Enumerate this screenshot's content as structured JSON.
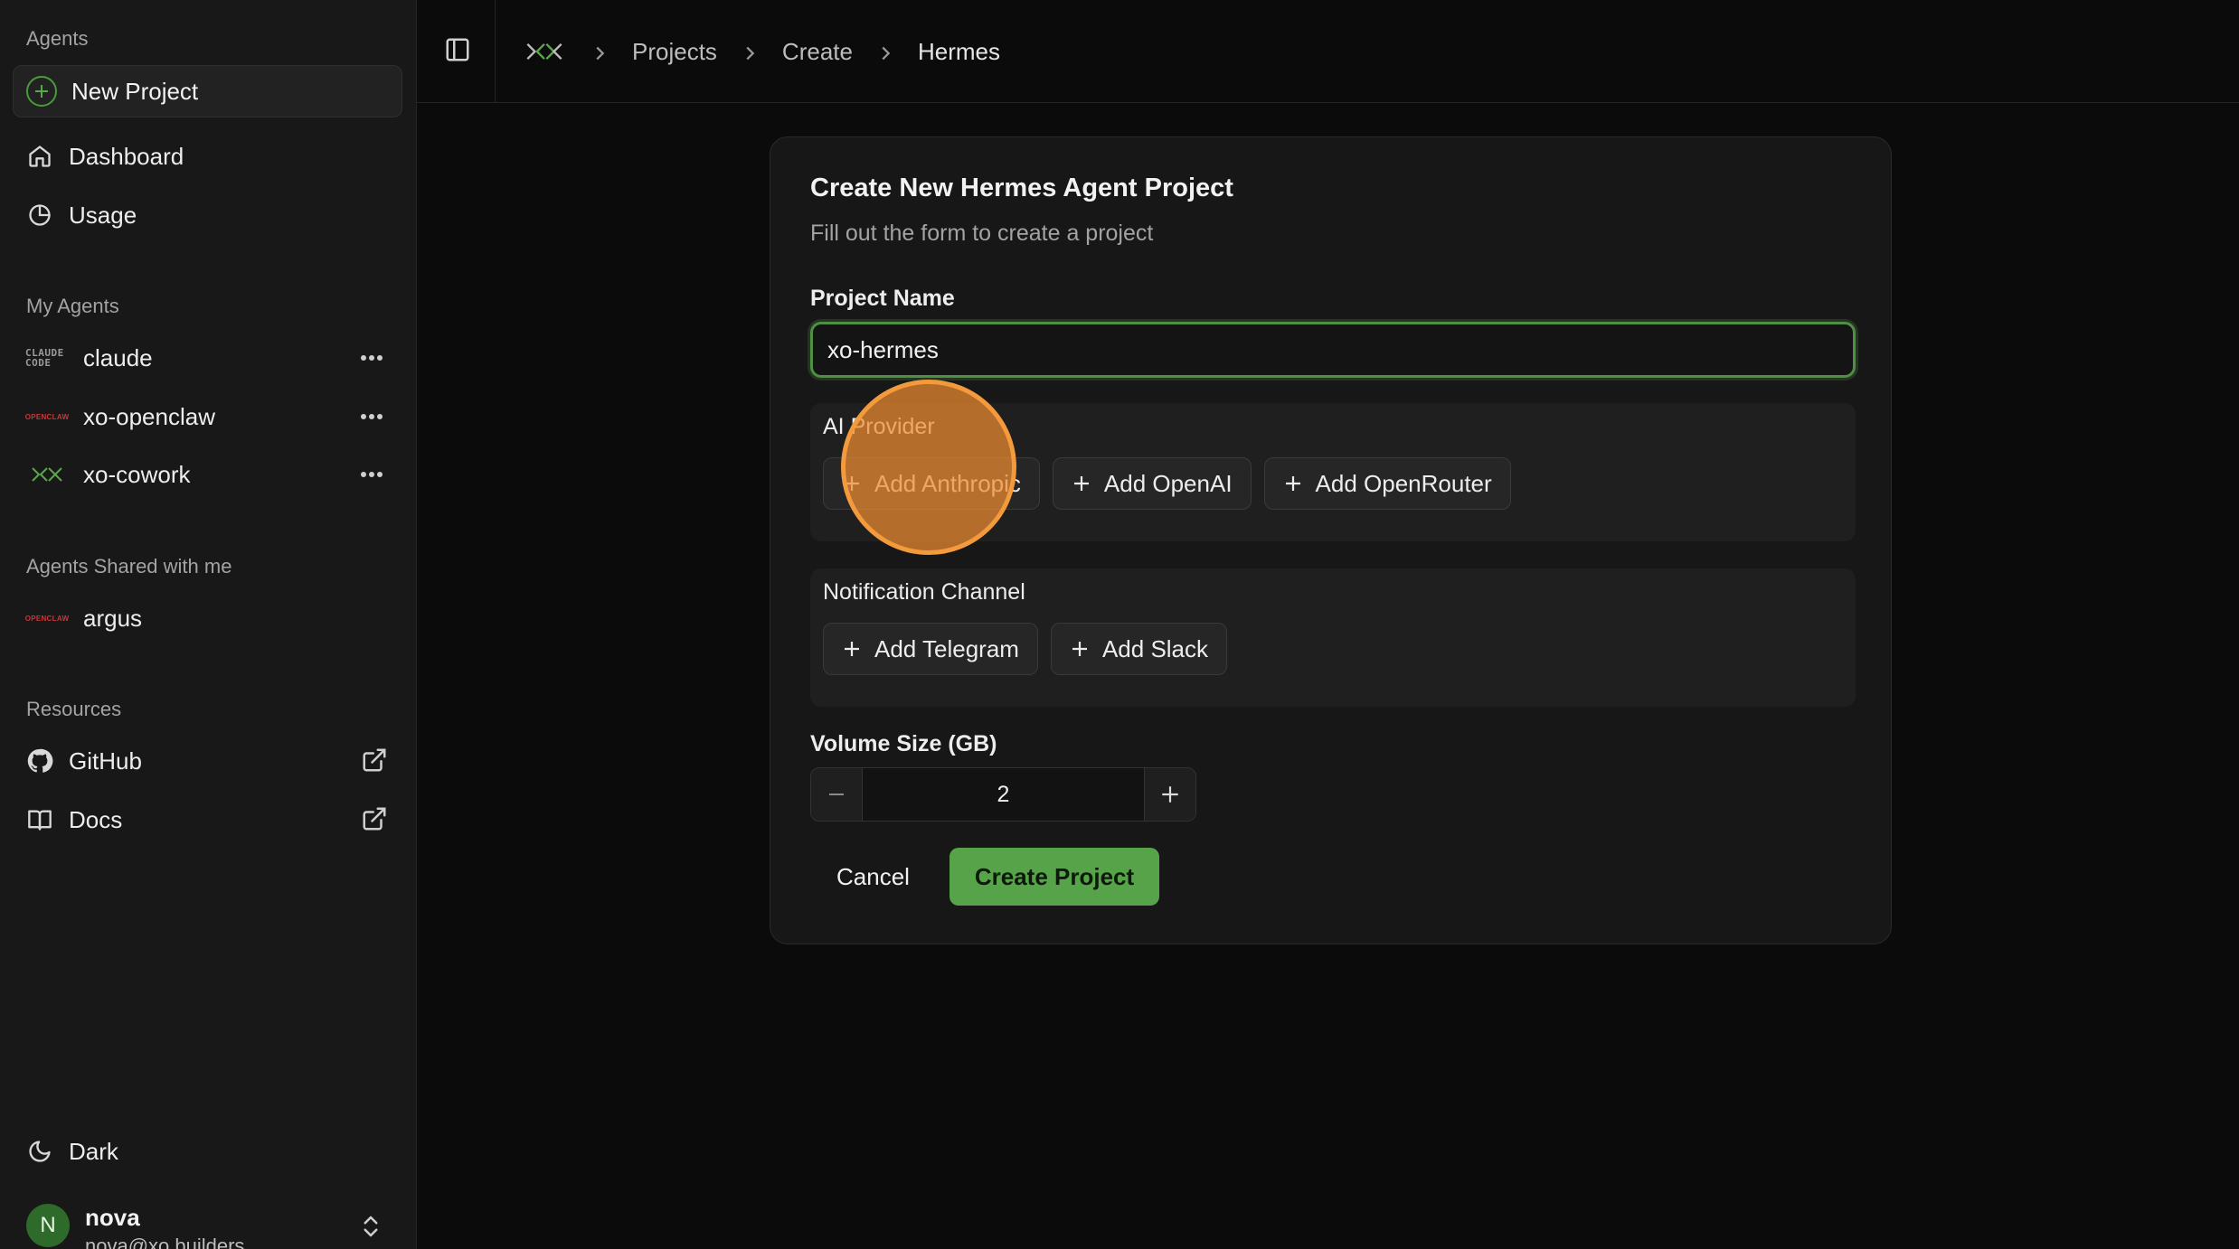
{
  "sidebar": {
    "section_agents": "Agents",
    "new_project": "New Project",
    "nav": [
      {
        "label": "Dashboard",
        "icon": "home-icon"
      },
      {
        "label": "Usage",
        "icon": "pie-chart-icon"
      }
    ],
    "section_my_agents": "My Agents",
    "my_agents": [
      {
        "label": "claude",
        "logo_text": "CLAUDE CODE"
      },
      {
        "label": "xo-openclaw",
        "logo_text": "OPENCLAW"
      },
      {
        "label": "xo-cowork"
      }
    ],
    "section_shared": "Agents Shared with me",
    "shared_agents": [
      {
        "label": "argus",
        "logo_text": "OPENCLAW"
      }
    ],
    "section_resources": "Resources",
    "resources": [
      {
        "label": "GitHub",
        "icon": "github-icon"
      },
      {
        "label": "Docs",
        "icon": "book-icon"
      }
    ],
    "theme_label": "Dark",
    "user": {
      "initial": "N",
      "name": "nova",
      "email": "nova@xo.builders"
    }
  },
  "breadcrumb": [
    "Projects",
    "Create",
    "Hermes"
  ],
  "form": {
    "title": "Create New Hermes Agent Project",
    "subtitle": "Fill out the form to create a project",
    "project_name_label": "Project Name",
    "project_name_value": "xo-hermes",
    "ai_provider_label": "AI Provider",
    "ai_provider_buttons": [
      "Add Anthropic",
      "Add OpenAI",
      "Add OpenRouter"
    ],
    "notification_label": "Notification Channel",
    "notification_buttons": [
      "Add Telegram",
      "Add Slack"
    ],
    "volume_label": "Volume Size (GB)",
    "volume_value": "2",
    "cancel_label": "Cancel",
    "create_label": "Create Project"
  },
  "colors": {
    "accent": "#57a349",
    "focus_ring": "#4f8f43",
    "click_indicator": "#f39a3c"
  }
}
